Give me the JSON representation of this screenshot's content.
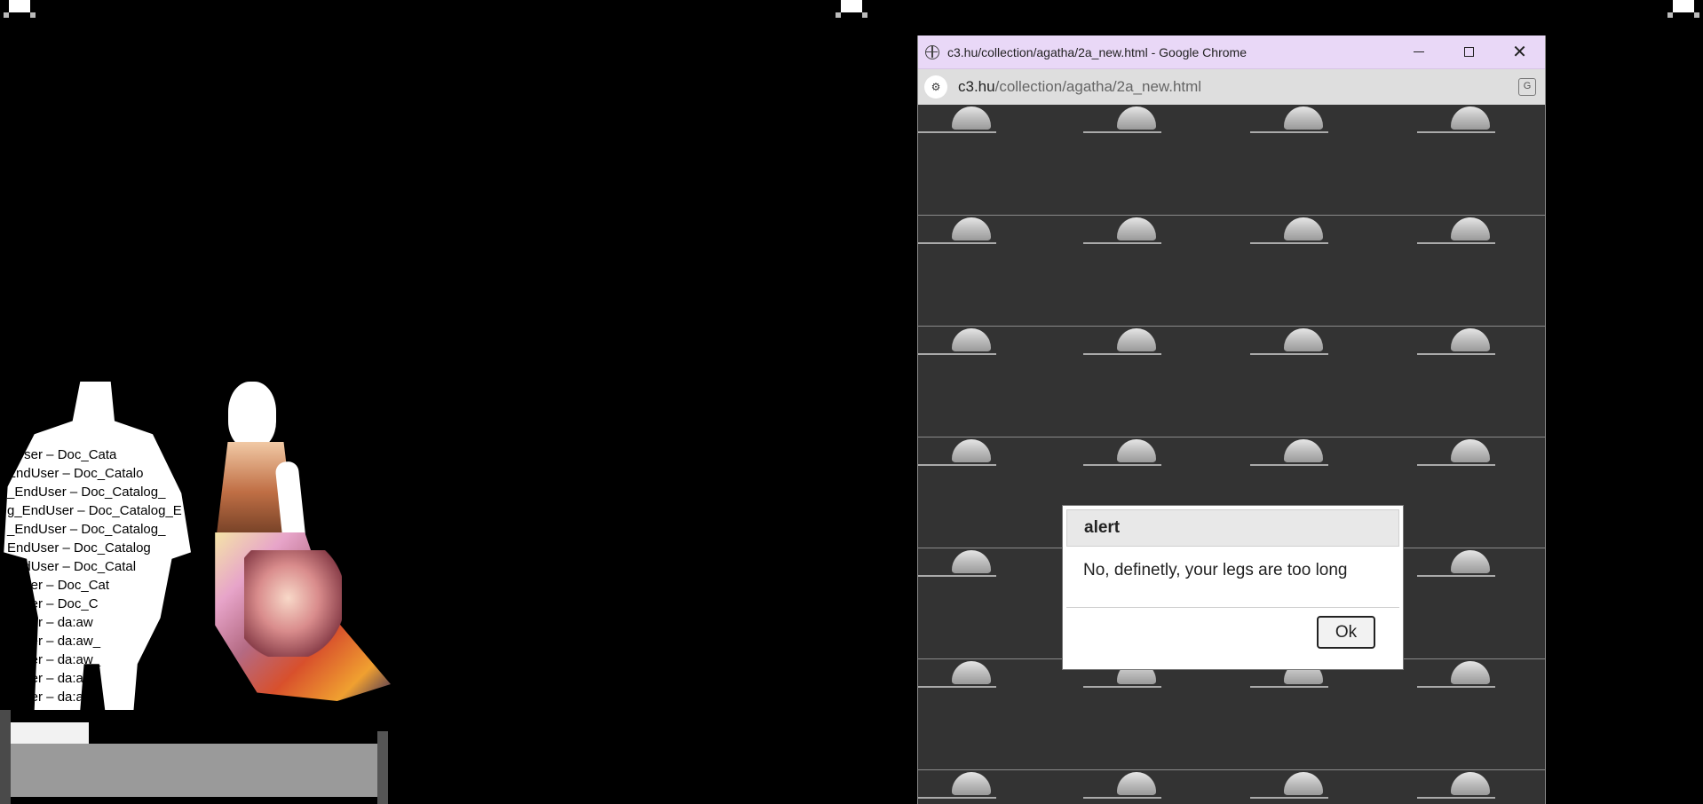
{
  "desktop": {
    "art_text_lines": [
      "dUser – Doc_Cata",
      "EndUser – Doc_Catalo",
      "_EndUser – Doc_Catalog_",
      "g_EndUser – Doc_Catalog_E",
      "_EndUser – Doc_Catalog_",
      "EndUser – Doc_Catalog",
      "EndUser – Doc_Catal",
      "dUser – Doc_Cat",
      "dUser – Doc_C",
      "dUser – da:aw",
      "dUser – da:aw_",
      "dUser – da:aw_",
      "dUser – da:aw",
      "dUser – da:a:"
    ]
  },
  "browser": {
    "title": "c3.hu/collection/agatha/2a_new.html - Google Chrome",
    "site_icon": "globe-icon",
    "url_host": "c3.hu",
    "url_path": "/collection/agatha/2a_new.html",
    "controls": {
      "minimize": "minimize-icon",
      "maximize": "maximize-icon",
      "close": "close-icon"
    },
    "accent_color": "#e9d8f7"
  },
  "alert": {
    "header": "alert",
    "message": "No, definetly, your legs are too long",
    "ok_label": "Ok"
  }
}
